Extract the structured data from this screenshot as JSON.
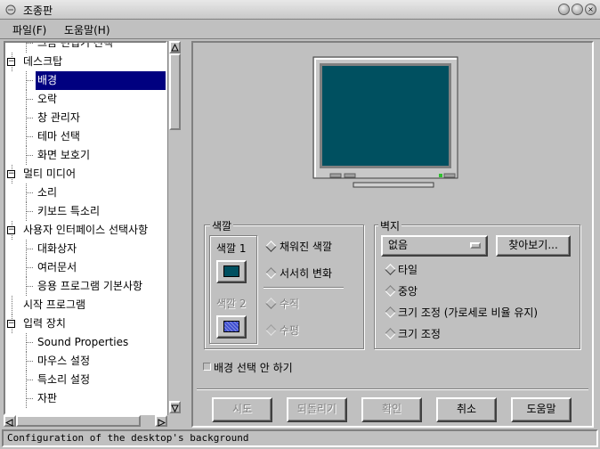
{
  "window": {
    "title": "조종판",
    "controls": [
      "minimize",
      "maximize",
      "close"
    ]
  },
  "menu": {
    "file": "파일(F)",
    "help": "도움말(H)"
  },
  "tree": [
    {
      "label": "그놈 편집기 선택",
      "level": 1,
      "expander": ""
    },
    {
      "label": "데스크탑",
      "level": 0,
      "expander": "minus"
    },
    {
      "label": "배경",
      "level": 1,
      "selected": true
    },
    {
      "label": "오락",
      "level": 1
    },
    {
      "label": "창 관리자",
      "level": 1
    },
    {
      "label": "테마 선택",
      "level": 1
    },
    {
      "label": "화면 보호기",
      "level": 1
    },
    {
      "label": "멀티 미디어",
      "level": 0,
      "expander": "minus"
    },
    {
      "label": "소리",
      "level": 1
    },
    {
      "label": "키보드 특소리",
      "level": 1
    },
    {
      "label": "사용자 인터페이스 선택사항",
      "level": 0,
      "expander": "minus"
    },
    {
      "label": "대화상자",
      "level": 1
    },
    {
      "label": "여러문서",
      "level": 1
    },
    {
      "label": "응용 프로그램 기본사항",
      "level": 1
    },
    {
      "label": "시작 프로그램",
      "level": 0
    },
    {
      "label": "입력 장치",
      "level": 0,
      "expander": "minus"
    },
    {
      "label": "Sound Properties",
      "level": 1
    },
    {
      "label": "마우스 설정",
      "level": 1
    },
    {
      "label": "특소리 설정",
      "level": 1
    },
    {
      "label": "자판",
      "level": 1
    }
  ],
  "monitor": {
    "screen_color": "#005060"
  },
  "color_group": {
    "title": "색깔",
    "color1_label": "색깔 1",
    "color1_value": "#005060",
    "color2_label": "색깔 2",
    "color2_value": "#4050d0",
    "fill_solid": "채워진 색깔",
    "fill_gradient": "서서히 변화",
    "vertical": "수직",
    "horizontal": "수평"
  },
  "wallpaper_group": {
    "title": "벽지",
    "selected": "없음",
    "browse": "찾아보기...",
    "tile": "타일",
    "center": "중앙",
    "scale_keep": "크기 조정 (가로세로 비율 유지)",
    "scale": "크기 조정"
  },
  "no_background": "배경 선택 안 하기",
  "buttons": {
    "try": "시도",
    "revert": "되돌리기",
    "ok": "확인",
    "cancel": "취소",
    "help": "도움말"
  },
  "status": "Configuration of the desktop's background"
}
